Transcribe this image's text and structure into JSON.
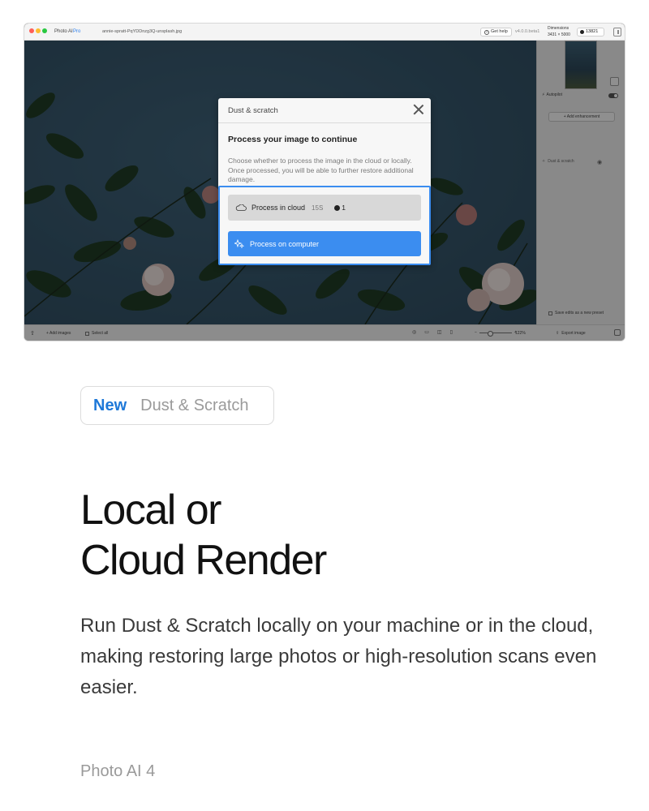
{
  "window": {
    "app_name": "Photo AI",
    "app_badge": "Pro",
    "file_name": "annie-spratt-PqYDDnzg3Q-unsplash.jpg",
    "help_label": "Get help",
    "version": "v4.0.0.beta1",
    "dimensions_label": "Dimensions",
    "dimensions_value": "3431 × 5000",
    "credits": "13821"
  },
  "sidebar": {
    "autopilot_label": "Autopilot",
    "add_enhancement_label": "+ Add enhancement",
    "dust_scratch_label": "Dust & scratch",
    "save_preset_label": "Save edits as a new preset"
  },
  "bottombar": {
    "add_images_label": "+ Add images",
    "select_all_label": "Select all",
    "zoom_value": "122%",
    "export_label": "Export image"
  },
  "modal": {
    "title": "Dust & scratch",
    "heading": "Process your image to continue",
    "description": "Choose whether to process the image in the cloud or locally. Once processed, you will be able to further restore additional damage.",
    "cloud_button": {
      "label": "Process in cloud",
      "estimate": "15S",
      "credits": "1"
    },
    "computer_button": {
      "label": "Process on computer"
    }
  },
  "marketing": {
    "badge_new": "New",
    "badge_feature": "Dust & Scratch",
    "headline_line1": "Local or",
    "headline_line2": "Cloud Render",
    "body": "Run Dust & Scratch locally on your machine or in the cloud, making restoring large photos or high-resolution scans even easier.",
    "product": "Photo AI 4"
  },
  "colors": {
    "accent": "#3b8df0",
    "new_badge": "#1e78d8",
    "canvas_bg": "#35556a"
  }
}
